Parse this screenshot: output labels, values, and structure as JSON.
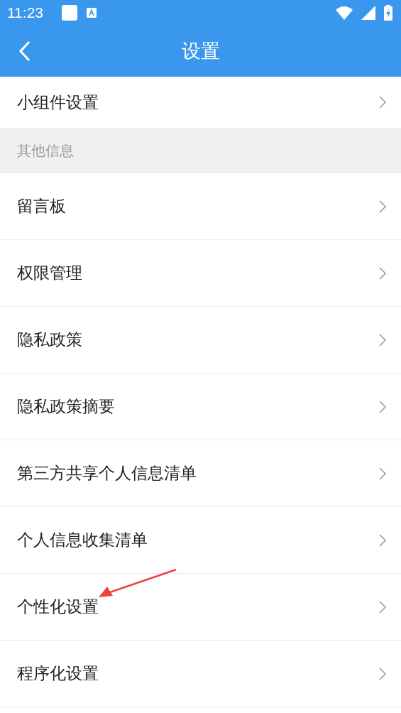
{
  "status_bar": {
    "time": "11:23"
  },
  "header": {
    "title": "设置"
  },
  "top_item": {
    "label": "小组件设置"
  },
  "section": {
    "title": "其他信息"
  },
  "items": [
    {
      "label": "留言板"
    },
    {
      "label": "权限管理"
    },
    {
      "label": "隐私政策"
    },
    {
      "label": "隐私政策摘要"
    },
    {
      "label": "第三方共享个人信息清单"
    },
    {
      "label": "个人信息收集清单"
    },
    {
      "label": "个性化设置"
    },
    {
      "label": "程序化设置"
    }
  ]
}
